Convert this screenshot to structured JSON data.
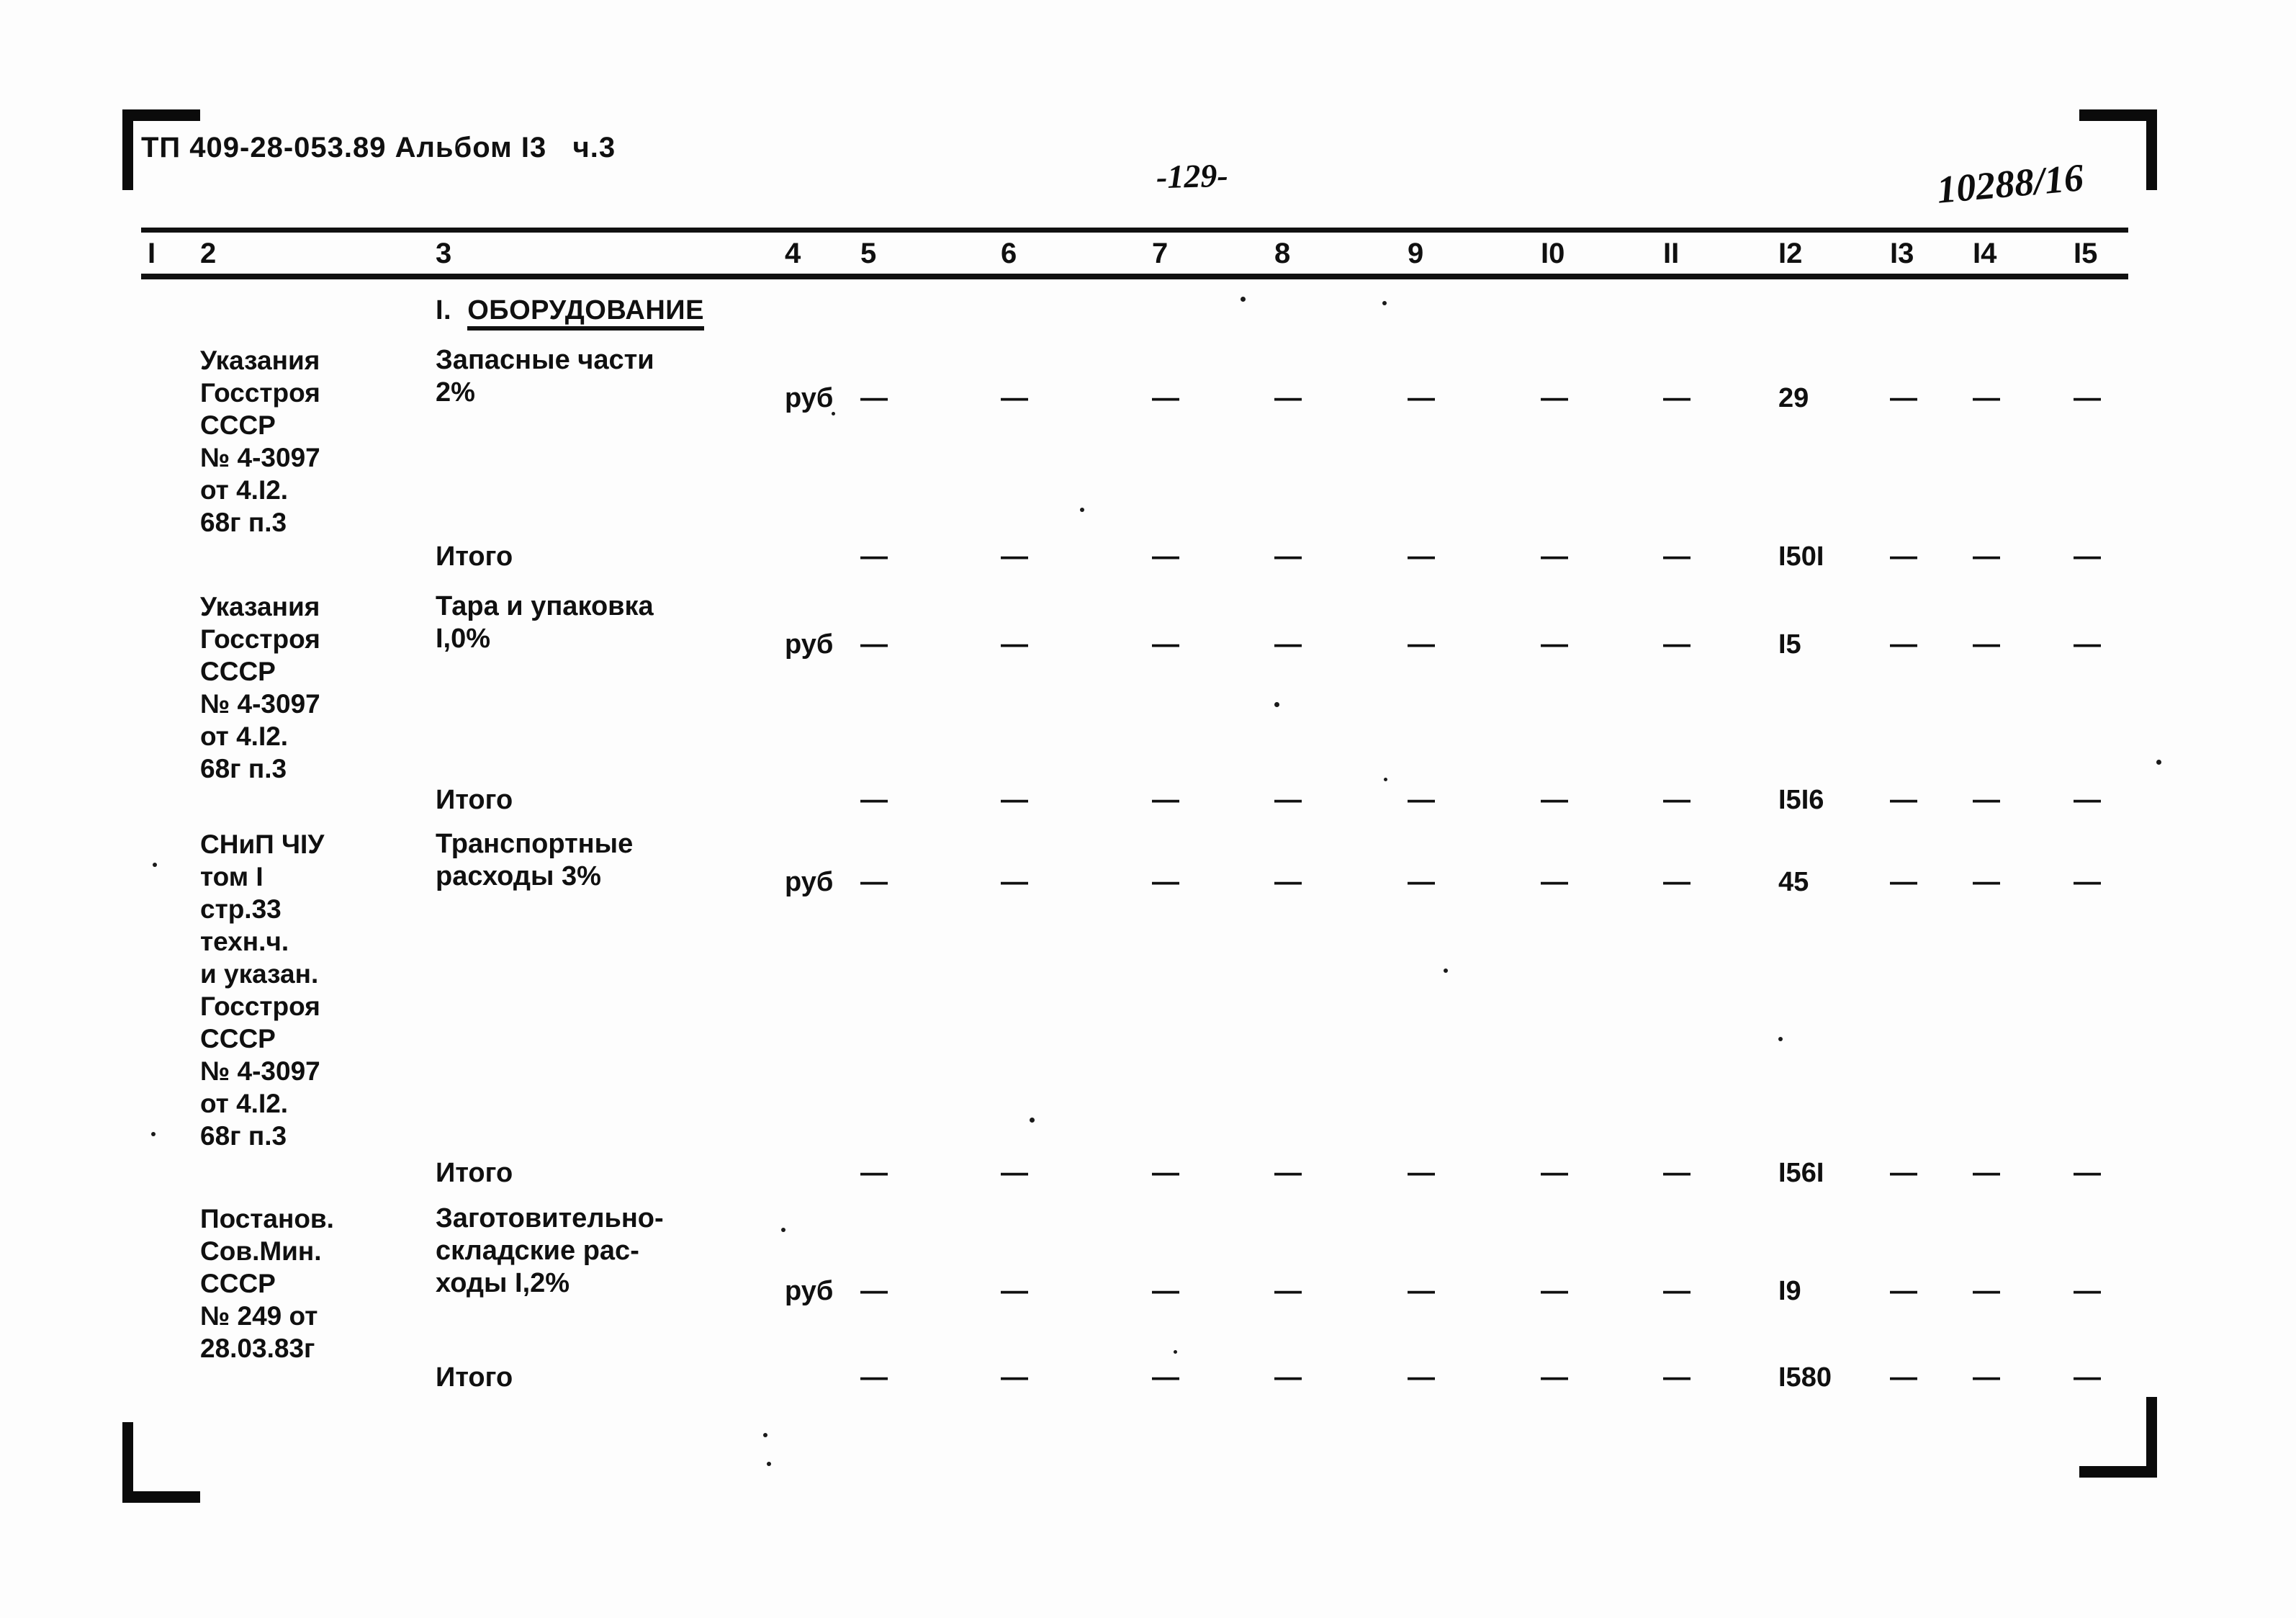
{
  "document": {
    "header": "ТП 409-28-053.89 Альбом I3   ч.3",
    "page_number": "-129-",
    "stamp_number": "10288/16"
  },
  "table": {
    "column_headers": [
      "I",
      "2",
      "3",
      "4",
      "5",
      "6",
      "7",
      "8",
      "9",
      "I0",
      "II",
      "I2",
      "I3",
      "I4",
      "I5"
    ],
    "section_title_prefix": "I.",
    "section_title": "ОБОРУДОВАНИЕ",
    "dash": "—",
    "rows": [
      {
        "kind": "item",
        "ref": "Указания\nГосстроя\nСССР\n№ 4-3097\nот 4.I2.\n68г п.3",
        "desc": "Запасные части\n2%",
        "unit": "руб",
        "c5": "—",
        "c6": "—",
        "c7": "—",
        "c8": "—",
        "c9": "—",
        "c10": "—",
        "c11": "—",
        "c12": "29",
        "c13": "—",
        "c14": "—",
        "c15": "—"
      },
      {
        "kind": "total",
        "desc": "Итого",
        "unit": "",
        "c5": "—",
        "c6": "—",
        "c7": "—",
        "c8": "—",
        "c9": "—",
        "c10": "—",
        "c11": "—",
        "c12": "I50I",
        "c13": "—",
        "c14": "—",
        "c15": "—"
      },
      {
        "kind": "item",
        "ref": "Указания\nГосстроя\nСССР\n№ 4-3097\nот 4.I2.\n68г п.3",
        "desc": "Тара и упаковка\nI,0%",
        "unit": "руб",
        "c5": "—",
        "c6": "—",
        "c7": "—",
        "c8": "—",
        "c9": "—",
        "c10": "—",
        "c11": "—",
        "c12": "I5",
        "c13": "—",
        "c14": "—",
        "c15": "—"
      },
      {
        "kind": "total",
        "desc": "Итого",
        "unit": "",
        "c5": "—",
        "c6": "—",
        "c7": "—",
        "c8": "—",
        "c9": "—",
        "c10": "—",
        "c11": "—",
        "c12": "I5I6",
        "c13": "—",
        "c14": "—",
        "c15": "—"
      },
      {
        "kind": "item",
        "ref": "СНиП ЧIУ\nтом I\nстр.33\nтехн.ч.\nи указан.\nГосстроя\nСССР\n№ 4-3097\nот 4.I2.\n68г п.3",
        "desc": "Транспортные\nрасходы 3%",
        "unit": "руб",
        "c5": "—",
        "c6": "—",
        "c7": "—",
        "c8": "—",
        "c9": "—",
        "c10": "—",
        "c11": "—",
        "c12": "45",
        "c13": "—",
        "c14": "—",
        "c15": "—"
      },
      {
        "kind": "total",
        "desc": "Итого",
        "unit": "",
        "c5": "—",
        "c6": "—",
        "c7": "—",
        "c8": "—",
        "c9": "—",
        "c10": "—",
        "c11": "—",
        "c12": "I56I",
        "c13": "—",
        "c14": "—",
        "c15": "—"
      },
      {
        "kind": "item",
        "ref": "Постанов.\nСов.Мин.\nСССР\n№ 249 от\n28.03.83г",
        "desc": "Заготовительно-\nскладские рас-\nходы I,2%",
        "unit": "руб",
        "c5": "—",
        "c6": "—",
        "c7": "—",
        "c8": "—",
        "c9": "—",
        "c10": "—",
        "c11": "—",
        "c12": "I9",
        "c13": "—",
        "c14": "—",
        "c15": "—"
      },
      {
        "kind": "total",
        "desc": "Итого",
        "unit": "",
        "c5": "—",
        "c6": "—",
        "c7": "—",
        "c8": "—",
        "c9": "—",
        "c10": "—",
        "c11": "—",
        "c12": "I580",
        "c13": "—",
        "c14": "—",
        "c15": "—"
      }
    ]
  }
}
